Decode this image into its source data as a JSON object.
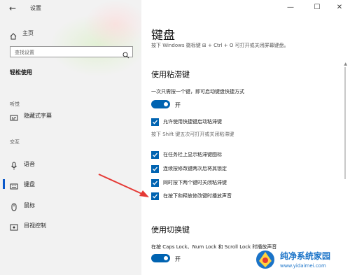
{
  "window": {
    "title": "设置",
    "controls": {
      "minimize": "—",
      "maximize": "☐",
      "close": "✕"
    }
  },
  "sidebar": {
    "home_label": "主页",
    "search_placeholder": "查找设置",
    "section_title": "轻松使用",
    "groups": [
      {
        "label": "听觉",
        "items": [
          {
            "label": "隐藏式字幕",
            "icon": "captions-icon"
          }
        ]
      },
      {
        "label": "交互",
        "items": [
          {
            "label": "语音",
            "icon": "microphone-icon"
          },
          {
            "label": "键盘",
            "icon": "keyboard-icon",
            "selected": true
          },
          {
            "label": "鼠标",
            "icon": "mouse-icon"
          },
          {
            "label": "目视控制",
            "icon": "eye-control-icon"
          }
        ]
      }
    ]
  },
  "main": {
    "page_title": "键盘",
    "description": "按下 Windows 徽标键 ⊞ + Ctrl + O 可打开或关闭屏幕键盘。",
    "sticky_keys": {
      "heading": "使用粘滞键",
      "instruction": "一次只需按一个键，即可启动键盘快捷方式",
      "toggle_label": "开",
      "toggle_on": true,
      "shortcut_option": "允许使用快捷键启动粘滞键",
      "shortcut_hint": "按下 Shift 键五次可打开或关闭粘滞键",
      "options": [
        {
          "label": "在任务栏上显示粘滞键图标",
          "checked": true
        },
        {
          "label": "连续按修改键两次后将其锁定",
          "checked": true
        },
        {
          "label": "同时按下两个键时关闭粘滞键",
          "checked": true
        },
        {
          "label": "在按下和释放修改键时播放声音",
          "checked": true
        }
      ]
    },
    "toggle_keys": {
      "heading": "使用切换键",
      "instruction": "在按 Caps Lock、Num Lock 和 Scroll Lock 时播放声音",
      "toggle_label": "开",
      "toggle_on": true
    }
  },
  "colors": {
    "accent": "#0063b1",
    "annotation_arrow": "#e53935",
    "sidebar_bg": "#f2f2f2"
  },
  "watermark": {
    "brand": "纯净系统家园",
    "url": "www.yidaimei.com"
  }
}
